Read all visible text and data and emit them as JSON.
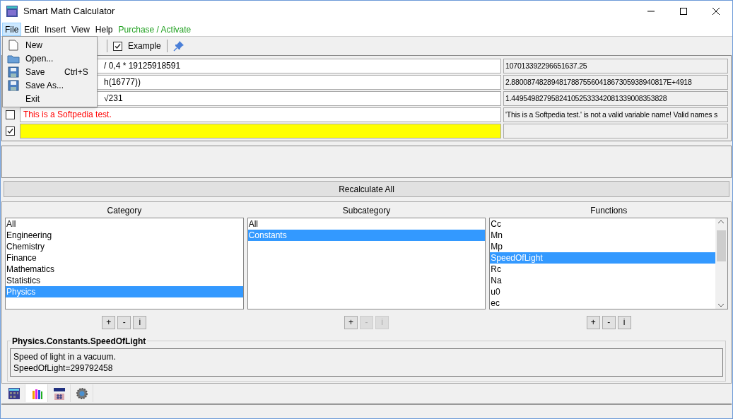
{
  "window": {
    "title": "Smart Math Calculator"
  },
  "menu_bar": [
    {
      "label": "File",
      "selected": true,
      "kind": "menu"
    },
    {
      "label": "Edit",
      "selected": false,
      "kind": "menu"
    },
    {
      "label": "Insert",
      "selected": false,
      "kind": "menu"
    },
    {
      "label": "View",
      "selected": false,
      "kind": "menu"
    },
    {
      "label": "Help",
      "selected": false,
      "kind": "menu"
    },
    {
      "label": "Purchase / Activate",
      "selected": false,
      "kind": "link"
    }
  ],
  "file_menu": [
    {
      "label": "New"
    },
    {
      "label": "Open..."
    },
    {
      "label": "Save",
      "shortcut": "Ctrl+S"
    },
    {
      "label": "Save As..."
    },
    {
      "label": "Exit"
    }
  ],
  "toolbar": {
    "example": {
      "label": "Example",
      "checked": true
    }
  },
  "expressions": [
    {
      "expression": "/ 0,4 * 19125918591",
      "result": "107013392296651637.25",
      "error": false
    },
    {
      "expression": "h(16777))",
      "result": "2.880087482894817887556041867305938940817E+4918",
      "error": false
    },
    {
      "expression": "√231",
      "result": "1.449549827958241052533342081339008353828",
      "error": false
    },
    {
      "expression": "This is a Softpedia test.",
      "result": "'This is a Softpedia test.' is not a valid variable name! Valid names s",
      "error": true,
      "checked": false
    },
    {
      "error": false,
      "checked": true,
      "active": true
    }
  ],
  "recalculate_button": "Recalculate All",
  "lists": [
    {
      "title": "Category",
      "items": [
        {
          "label": "All",
          "selected": false
        },
        {
          "label": "Engineering",
          "selected": false
        },
        {
          "label": "Chemistry",
          "selected": false
        },
        {
          "label": "Finance",
          "selected": false
        },
        {
          "label": "Mathematics",
          "selected": false
        },
        {
          "label": "Statistics",
          "selected": false
        },
        {
          "label": "Physics",
          "selected": true
        }
      ],
      "buttons": [
        {
          "label": "+",
          "disabled": false
        },
        {
          "label": "-",
          "disabled": false
        },
        {
          "label": "i",
          "disabled": false
        }
      ],
      "scrollbar": false
    },
    {
      "title": "Subcategory",
      "items": [
        {
          "label": "All",
          "selected": false
        },
        {
          "label": "Constants",
          "selected": true
        }
      ],
      "buttons": [
        {
          "label": "+",
          "disabled": false
        },
        {
          "label": "-",
          "disabled": true
        },
        {
          "label": "i",
          "disabled": true
        }
      ],
      "scrollbar": false
    },
    {
      "title": "Functions",
      "items": [
        {
          "label": "Cc",
          "selected": false
        },
        {
          "label": "Mn",
          "selected": false
        },
        {
          "label": "Mp",
          "selected": false
        },
        {
          "label": "SpeedOfLight",
          "selected": true
        },
        {
          "label": "Rc",
          "selected": false
        },
        {
          "label": "Na",
          "selected": false
        },
        {
          "label": "u0",
          "selected": false
        },
        {
          "label": "ec",
          "selected": false
        }
      ],
      "buttons": [
        {
          "label": "+",
          "disabled": false
        },
        {
          "label": "-",
          "disabled": false
        },
        {
          "label": "i",
          "disabled": false
        }
      ],
      "scrollbar": true
    }
  ],
  "details": {
    "title": "Physics.Constants.SpeedOfLight",
    "lines": [
      "Speed of light in a vacuum.",
      "SpeedOfLight=299792458"
    ]
  },
  "bottom_tabs": [
    {
      "selected": false
    },
    {
      "selected": true
    },
    {
      "selected": false
    },
    {
      "selected": false
    }
  ]
}
